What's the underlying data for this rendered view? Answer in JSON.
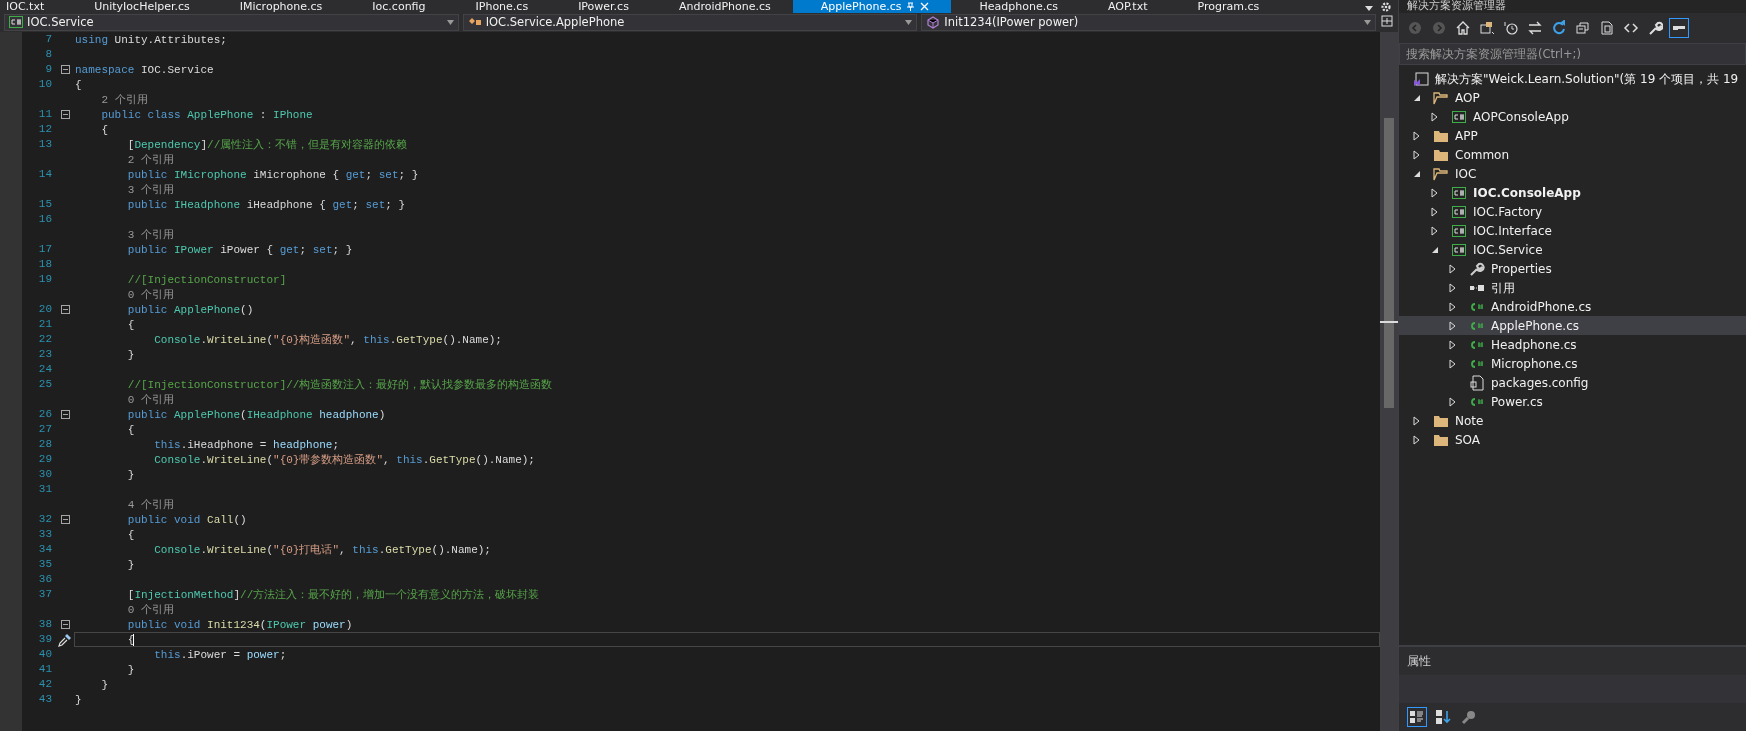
{
  "document_tabs": [
    {
      "label": "IOC.txt",
      "selected": false
    },
    {
      "label": "UnityIocHelper.cs",
      "selected": false
    },
    {
      "label": "IMicrophone.cs",
      "selected": false
    },
    {
      "label": "Ioc.config",
      "selected": false
    },
    {
      "label": "IPhone.cs",
      "selected": false
    },
    {
      "label": "IPower.cs",
      "selected": false
    },
    {
      "label": "AndroidPhone.cs",
      "selected": false
    },
    {
      "label": "ApplePhone.cs",
      "selected": true
    },
    {
      "label": "Headphone.cs",
      "selected": false
    },
    {
      "label": "AOP.txt",
      "selected": false
    },
    {
      "label": "Program.cs",
      "selected": false
    }
  ],
  "navigation_bar": {
    "project": "IOC.Service",
    "type": "IOC.Service.ApplePhone",
    "member": "Init1234(IPower power)"
  },
  "editor": {
    "lines": [
      {
        "kind": "code",
        "number": "7",
        "segments": [
          {
            "kind": "keyword",
            "text": "using"
          },
          {
            "kind": "plain",
            "text": " Unity.Attributes;"
          }
        ]
      },
      {
        "kind": "code",
        "number": "8"
      },
      {
        "kind": "code",
        "number": "9",
        "fold": true,
        "segments": [
          {
            "kind": "keyword",
            "text": "namespace"
          },
          {
            "kind": "plain",
            "text": " IOC.Service"
          }
        ]
      },
      {
        "kind": "code",
        "number": "10",
        "segments": [
          {
            "kind": "plain",
            "text": "{"
          }
        ]
      },
      {
        "kind": "codelens",
        "text": "    2 个引用"
      },
      {
        "kind": "code",
        "number": "11",
        "fold": true,
        "segments": [
          {
            "kind": "keyword",
            "text": "    public"
          },
          {
            "kind": "keyword",
            "text": " class"
          },
          {
            "kind": "type",
            "text": " ApplePhone"
          },
          {
            "kind": "plain",
            "text": " :"
          },
          {
            "kind": "type",
            "text": " IPhone"
          }
        ]
      },
      {
        "kind": "code",
        "number": "12",
        "segments": [
          {
            "kind": "plain",
            "text": "    {"
          }
        ]
      },
      {
        "kind": "code",
        "number": "13",
        "segments": [
          {
            "kind": "plain",
            "text": "        ["
          },
          {
            "kind": "type",
            "text": "Dependency"
          },
          {
            "kind": "plain",
            "text": "]"
          },
          {
            "kind": "comment",
            "text": "//属性注入：不错，但是有对容器的依赖"
          }
        ]
      },
      {
        "kind": "codelens",
        "text": "        2 个引用"
      },
      {
        "kind": "code",
        "number": "14",
        "segments": [
          {
            "kind": "keyword",
            "text": "        public"
          },
          {
            "kind": "type",
            "text": " IMicrophone"
          },
          {
            "kind": "plain",
            "text": " iMicrophone {"
          },
          {
            "kind": "keyword",
            "text": " get"
          },
          {
            "kind": "plain",
            "text": ";"
          },
          {
            "kind": "keyword",
            "text": " set"
          },
          {
            "kind": "plain",
            "text": "; }"
          }
        ]
      },
      {
        "kind": "codelens",
        "text": "        3 个引用"
      },
      {
        "kind": "code",
        "number": "15",
        "segments": [
          {
            "kind": "keyword",
            "text": "        public"
          },
          {
            "kind": "type",
            "text": " IHeadphone"
          },
          {
            "kind": "plain",
            "text": " iHeadphone {"
          },
          {
            "kind": "keyword",
            "text": " get"
          },
          {
            "kind": "plain",
            "text": ";"
          },
          {
            "kind": "keyword",
            "text": " set"
          },
          {
            "kind": "plain",
            "text": "; }"
          }
        ]
      },
      {
        "kind": "code",
        "number": "16"
      },
      {
        "kind": "codelens",
        "text": "        3 个引用"
      },
      {
        "kind": "code",
        "number": "17",
        "segments": [
          {
            "kind": "keyword",
            "text": "        public"
          },
          {
            "kind": "type",
            "text": " IPower"
          },
          {
            "kind": "plain",
            "text": " iPower {"
          },
          {
            "kind": "keyword",
            "text": " get"
          },
          {
            "kind": "plain",
            "text": ";"
          },
          {
            "kind": "keyword",
            "text": " set"
          },
          {
            "kind": "plain",
            "text": "; }"
          }
        ]
      },
      {
        "kind": "code",
        "number": "18"
      },
      {
        "kind": "code",
        "number": "19",
        "segments": [
          {
            "kind": "comment",
            "text": "        //[InjectionConstructor]"
          }
        ]
      },
      {
        "kind": "codelens",
        "text": "        0 个引用"
      },
      {
        "kind": "code",
        "number": "20",
        "fold": true,
        "segments": [
          {
            "kind": "keyword",
            "text": "        public"
          },
          {
            "kind": "type",
            "text": " ApplePhone"
          },
          {
            "kind": "plain",
            "text": "()"
          }
        ]
      },
      {
        "kind": "code",
        "number": "21",
        "segments": [
          {
            "kind": "plain",
            "text": "        {"
          }
        ]
      },
      {
        "kind": "code",
        "number": "22",
        "segments": [
          {
            "kind": "type",
            "text": "            Console"
          },
          {
            "kind": "plain",
            "text": "."
          },
          {
            "kind": "method",
            "text": "WriteLine"
          },
          {
            "kind": "plain",
            "text": "("
          },
          {
            "kind": "string",
            "text": "\"{0}构造函数\""
          },
          {
            "kind": "plain",
            "text": ","
          },
          {
            "kind": "keyword",
            "text": " this"
          },
          {
            "kind": "plain",
            "text": "."
          },
          {
            "kind": "method",
            "text": "GetType"
          },
          {
            "kind": "plain",
            "text": "().Name);"
          }
        ]
      },
      {
        "kind": "code",
        "number": "23",
        "segments": [
          {
            "kind": "plain",
            "text": "        }"
          }
        ]
      },
      {
        "kind": "code",
        "number": "24"
      },
      {
        "kind": "code",
        "number": "25",
        "segments": [
          {
            "kind": "comment",
            "text": "        //[InjectionConstructor]//构造函数注入：最好的，默认找参数最多的构造函数"
          }
        ]
      },
      {
        "kind": "codelens",
        "text": "        0 个引用"
      },
      {
        "kind": "code",
        "number": "26",
        "fold": true,
        "segments": [
          {
            "kind": "keyword",
            "text": "        public"
          },
          {
            "kind": "type",
            "text": " ApplePhone"
          },
          {
            "kind": "plain",
            "text": "("
          },
          {
            "kind": "type",
            "text": "IHeadphone"
          },
          {
            "kind": "param",
            "text": " headphone"
          },
          {
            "kind": "plain",
            "text": ")"
          }
        ]
      },
      {
        "kind": "code",
        "number": "27",
        "segments": [
          {
            "kind": "plain",
            "text": "        {"
          }
        ]
      },
      {
        "kind": "code",
        "number": "28",
        "segments": [
          {
            "kind": "keyword",
            "text": "            this"
          },
          {
            "kind": "plain",
            "text": ".iHeadphone ="
          },
          {
            "kind": "param",
            "text": " headphone"
          },
          {
            "kind": "plain",
            "text": ";"
          }
        ]
      },
      {
        "kind": "code",
        "number": "29",
        "segments": [
          {
            "kind": "type",
            "text": "            Console"
          },
          {
            "kind": "plain",
            "text": "."
          },
          {
            "kind": "method",
            "text": "WriteLine"
          },
          {
            "kind": "plain",
            "text": "("
          },
          {
            "kind": "string",
            "text": "\"{0}带参数构造函数\""
          },
          {
            "kind": "plain",
            "text": ","
          },
          {
            "kind": "keyword",
            "text": " this"
          },
          {
            "kind": "plain",
            "text": "."
          },
          {
            "kind": "method",
            "text": "GetType"
          },
          {
            "kind": "plain",
            "text": "().Name);"
          }
        ]
      },
      {
        "kind": "code",
        "number": "30",
        "segments": [
          {
            "kind": "plain",
            "text": "        }"
          }
        ]
      },
      {
        "kind": "code",
        "number": "31"
      },
      {
        "kind": "codelens",
        "text": "        4 个引用"
      },
      {
        "kind": "code",
        "number": "32",
        "fold": true,
        "segments": [
          {
            "kind": "keyword",
            "text": "        public"
          },
          {
            "kind": "keyword",
            "text": " void"
          },
          {
            "kind": "method",
            "text": " Call"
          },
          {
            "kind": "plain",
            "text": "()"
          }
        ]
      },
      {
        "kind": "code",
        "number": "33",
        "segments": [
          {
            "kind": "plain",
            "text": "        {"
          }
        ]
      },
      {
        "kind": "code",
        "number": "34",
        "segments": [
          {
            "kind": "type",
            "text": "            Console"
          },
          {
            "kind": "plain",
            "text": "."
          },
          {
            "kind": "method",
            "text": "WriteLine"
          },
          {
            "kind": "plain",
            "text": "("
          },
          {
            "kind": "string",
            "text": "\"{0}打电话\""
          },
          {
            "kind": "plain",
            "text": ","
          },
          {
            "kind": "keyword",
            "text": " this"
          },
          {
            "kind": "plain",
            "text": "."
          },
          {
            "kind": "method",
            "text": "GetType"
          },
          {
            "kind": "plain",
            "text": "().Name);"
          }
        ]
      },
      {
        "kind": "code",
        "number": "35",
        "segments": [
          {
            "kind": "plain",
            "text": "        }"
          }
        ]
      },
      {
        "kind": "code",
        "number": "36"
      },
      {
        "kind": "code",
        "number": "37",
        "segments": [
          {
            "kind": "plain",
            "text": "        ["
          },
          {
            "kind": "type",
            "text": "InjectionMethod"
          },
          {
            "kind": "plain",
            "text": "]"
          },
          {
            "kind": "comment",
            "text": "//方法注入：最不好的，增加一个没有意义的方法，破坏封装"
          }
        ]
      },
      {
        "kind": "codelens",
        "text": "        0 个引用"
      },
      {
        "kind": "code",
        "number": "38",
        "fold": true,
        "segments": [
          {
            "kind": "keyword",
            "text": "        public"
          },
          {
            "kind": "keyword",
            "text": " void"
          },
          {
            "kind": "method",
            "text": " Init1234"
          },
          {
            "kind": "plain",
            "text": "("
          },
          {
            "kind": "type",
            "text": "IPower"
          },
          {
            "kind": "param",
            "text": " power"
          },
          {
            "kind": "plain",
            "text": ")"
          }
        ]
      },
      {
        "kind": "code",
        "number": "39",
        "current": true,
        "segments": [
          {
            "kind": "plain",
            "text": "        {"
          }
        ]
      },
      {
        "kind": "code",
        "number": "40",
        "segments": [
          {
            "kind": "keyword",
            "text": "            this"
          },
          {
            "kind": "plain",
            "text": ".iPower ="
          },
          {
            "kind": "param",
            "text": " power"
          },
          {
            "kind": "plain",
            "text": ";"
          }
        ]
      },
      {
        "kind": "code",
        "number": "41",
        "segments": [
          {
            "kind": "plain",
            "text": "        }"
          }
        ]
      },
      {
        "kind": "code",
        "number": "42",
        "segments": [
          {
            "kind": "plain",
            "text": "    }"
          }
        ]
      },
      {
        "kind": "code",
        "number": "43",
        "segments": [
          {
            "kind": "plain",
            "text": "}"
          }
        ]
      }
    ]
  },
  "solution_explorer": {
    "title": "解决方案资源管理器",
    "toolbar": [
      {
        "kind": "back",
        "selected": false
      },
      {
        "kind": "forward",
        "selected": false
      },
      {
        "kind": "home",
        "selected": false
      },
      {
        "kind": "switch-views",
        "selected": false
      },
      {
        "kind": "pending-changes",
        "selected": false
      },
      {
        "kind": "sync",
        "selected": false
      },
      {
        "kind": "refresh",
        "selected": false
      },
      {
        "kind": "collapse-all",
        "selected": false
      },
      {
        "kind": "show-all-files",
        "selected": false
      },
      {
        "kind": "view-code",
        "selected": false
      },
      {
        "kind": "properties",
        "selected": false
      },
      {
        "kind": "preview",
        "selected": true
      }
    ],
    "search": {
      "placeholder": "搜索解决方案资源管理器(Ctrl+;)"
    },
    "tree": [
      {
        "label": "解决方案\"Weick.Learn.Solution\"(第 19 个项目，共 19",
        "kind": "solution",
        "selected": false,
        "children": [
          {
            "label": "AOP",
            "kind": "folder",
            "expanded": true,
            "selected": false,
            "children": [
              {
                "label": "AOPConsoleApp",
                "kind": "project",
                "bold": false,
                "expanded": false,
                "selected": false
              }
            ]
          },
          {
            "label": "APP",
            "kind": "folder",
            "expanded": false,
            "selected": false
          },
          {
            "label": "Common",
            "kind": "folder",
            "expanded": false,
            "selected": false
          },
          {
            "label": "IOC",
            "kind": "folder",
            "expanded": true,
            "selected": false,
            "children": [
              {
                "label": "IOC.ConsoleApp",
                "kind": "project",
                "bold": true,
                "expanded": false,
                "selected": false
              },
              {
                "label": "IOC.Factory",
                "kind": "project",
                "bold": false,
                "expanded": false,
                "selected": false
              },
              {
                "label": "IOC.Interface",
                "kind": "project",
                "bold": false,
                "expanded": false,
                "selected": false
              },
              {
                "label": "IOC.Service",
                "kind": "project",
                "bold": false,
                "expanded": true,
                "selected": false,
                "children": [
                  {
                    "label": "Properties",
                    "kind": "properties",
                    "expanded": false,
                    "selected": false
                  },
                  {
                    "label": "引用",
                    "kind": "references",
                    "expanded": false,
                    "selected": false
                  },
                  {
                    "label": "AndroidPhone.cs",
                    "kind": "csfile",
                    "expanded": false,
                    "selected": false
                  },
                  {
                    "label": "ApplePhone.cs",
                    "kind": "csfile",
                    "expanded": false,
                    "selected": true
                  },
                  {
                    "label": "Headphone.cs",
                    "kind": "csfile",
                    "expanded": false,
                    "selected": false
                  },
                  {
                    "label": "Microphone.cs",
                    "kind": "csfile",
                    "expanded": false,
                    "selected": false
                  },
                  {
                    "label": "packages.config",
                    "kind": "config",
                    "selected": false
                  },
                  {
                    "label": "Power.cs",
                    "kind": "csfile",
                    "expanded": false,
                    "selected": false
                  }
                ]
              }
            ]
          },
          {
            "label": "Note",
            "kind": "folder",
            "expanded": false,
            "selected": false
          },
          {
            "label": "SOA",
            "kind": "folder",
            "expanded": false,
            "selected": false
          }
        ]
      }
    ]
  },
  "properties_panel": {
    "title": "属性",
    "toolbar": [
      {
        "kind": "categorized",
        "selected": true
      },
      {
        "kind": "alphabetical",
        "selected": false
      },
      {
        "kind": "property-pages",
        "selected": false
      }
    ]
  }
}
